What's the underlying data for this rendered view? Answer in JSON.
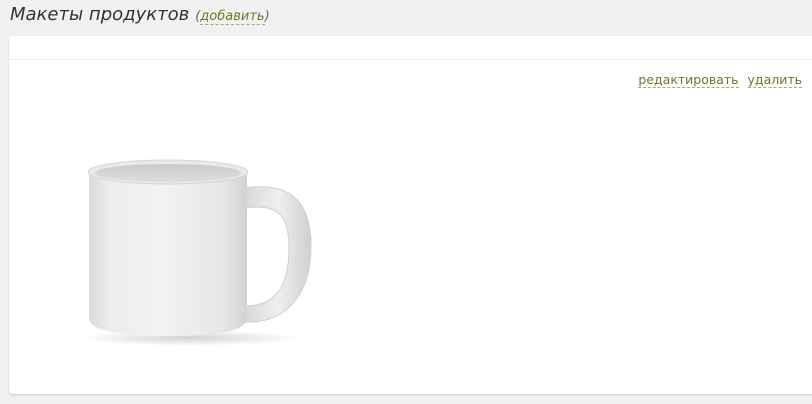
{
  "header": {
    "title": "Макеты продуктов",
    "add_open": "(",
    "add_label": "добавить",
    "add_close": ")"
  },
  "item": {
    "edit_label": "редактировать",
    "delete_label": "удалить",
    "image_icon": "mug-image"
  },
  "colors": {
    "link": "#5e7d2a",
    "background": "#f1f1f1",
    "panel": "#ffffff"
  }
}
